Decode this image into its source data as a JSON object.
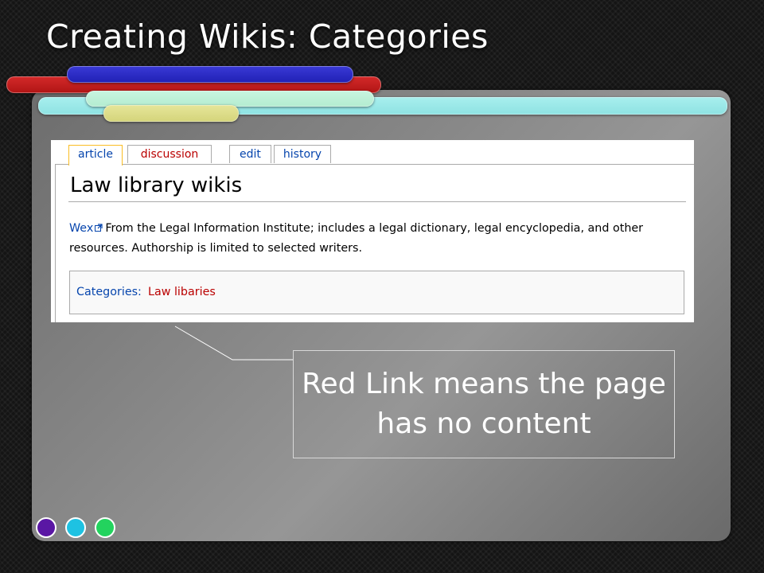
{
  "slide": {
    "title": "Creating Wikis: Categories",
    "callout_text": "Red Link means the page has no content"
  },
  "wiki": {
    "tabs": [
      {
        "label": "article",
        "selected": true
      },
      {
        "label": "discussion",
        "selected": false,
        "color": "#ba0000"
      },
      {
        "label": "edit",
        "selected": false
      },
      {
        "label": "history",
        "selected": false
      }
    ],
    "heading": "Law library wikis",
    "paragraph": {
      "link_text": "Wex",
      "link_icon": "external-link-icon",
      "text": "From the Legal Information Institute; includes a legal dictionary, legal encyclopedia, and other resources. Authorship is limited to selected writers."
    },
    "categories": {
      "label": "Categories:",
      "link_text": "Law libaries",
      "link_color": "#ba0000"
    }
  },
  "colors": {
    "blue_link": "#0645ad",
    "red_link": "#ba0000",
    "selected_tab_border": "#fabd23",
    "panel": "#888888",
    "dots": [
      "#5a17a4",
      "#1ec2e2",
      "#23d35e"
    ]
  }
}
